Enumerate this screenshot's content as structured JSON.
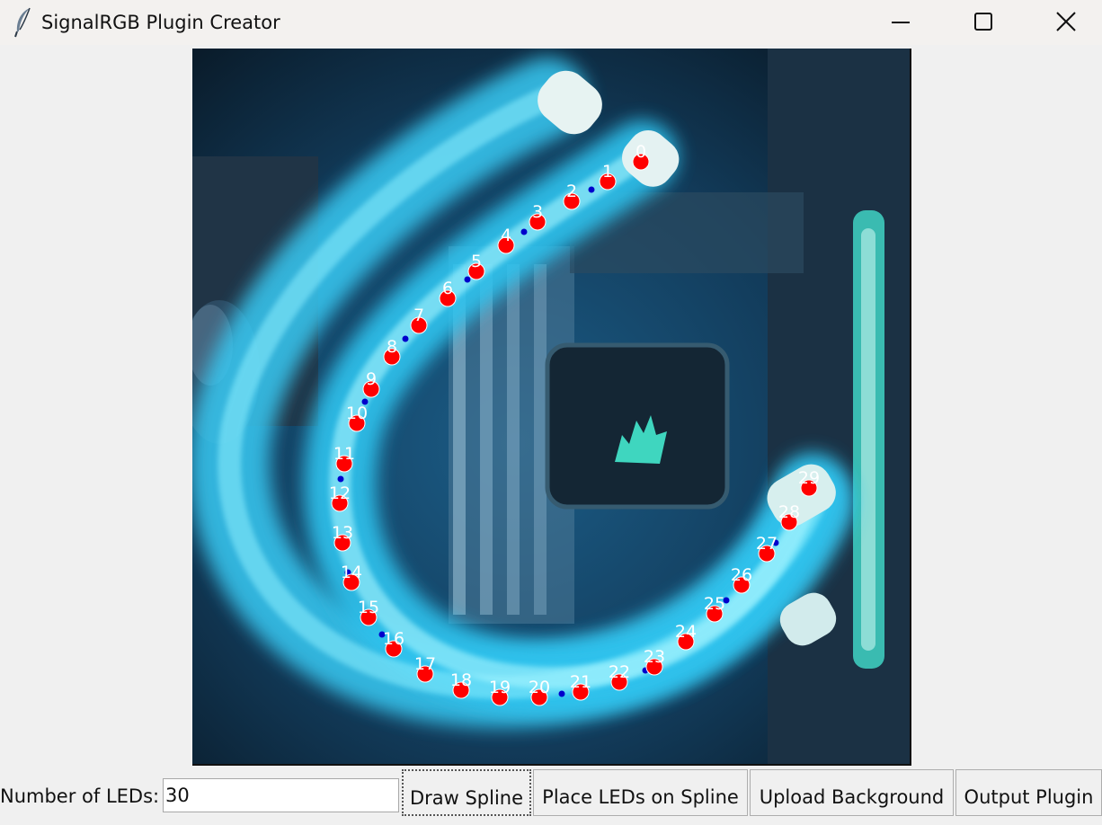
{
  "window": {
    "title": "SignalRGB Plugin Creator",
    "app_icon": "feather-icon",
    "controls": [
      "minimize-icon",
      "maximize-icon",
      "close-icon"
    ]
  },
  "canvas": {
    "background_description_icon": "corsair-logo-icon",
    "led_color": "#ff0000",
    "control_point_color": "#0000cc",
    "label_color": "#ffffff",
    "leds": [
      "0",
      "1",
      "2",
      "3",
      "4",
      "5",
      "6",
      "7",
      "8",
      "9",
      "10",
      "11",
      "12",
      "13",
      "14",
      "15",
      "16",
      "17",
      "18",
      "19",
      "20",
      "21",
      "22",
      "23",
      "24",
      "25",
      "26",
      "27",
      "28",
      "29"
    ]
  },
  "bottom_bar": {
    "leds_label": "Number of LEDs:",
    "leds_value": "30",
    "buttons": {
      "draw": "Draw Spline",
      "place": "Place LEDs on Spline",
      "upload": "Upload Background",
      "output": "Output Plugin"
    }
  }
}
